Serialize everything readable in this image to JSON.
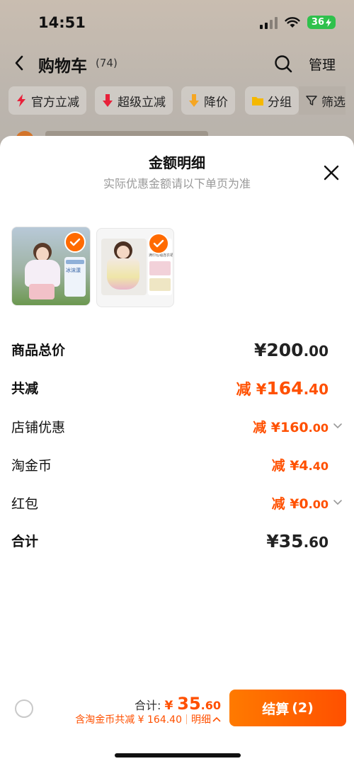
{
  "status_bar": {
    "time": "14:51",
    "battery": "36"
  },
  "nav": {
    "title": "购物车",
    "count": "(74)",
    "manage_label": "管理"
  },
  "filters": [
    {
      "label": "官方立减",
      "icon": "lightning-icon",
      "color": "#e8213a"
    },
    {
      "label": "超级立减",
      "icon": "down-arrow-icon",
      "color": "#e8213a"
    },
    {
      "label": "降价",
      "icon": "price-drop-icon",
      "color": "#f5a623"
    },
    {
      "label": "分组",
      "icon": "folder-icon",
      "color": "#f5b800"
    }
  ],
  "filter_button_label": "筛选",
  "sheet": {
    "title": "金额明细",
    "subtitle": "实际优惠金额请以下单页为准",
    "products": [
      {
        "name": "girl-outfit-thumbnail",
        "selected": true,
        "label": "冰沫漾"
      },
      {
        "name": "girl-dress-thumbnail",
        "selected": true,
        "label": "满印短袖连衣裙"
      }
    ],
    "rows": {
      "goods_total": {
        "label": "商品总价",
        "symbol": "¥",
        "integer": "200",
        "decimal": ".00"
      },
      "total_reduce": {
        "label": "共减",
        "prefix": "减 ",
        "symbol": "¥",
        "integer": "164",
        "decimal": ".40"
      },
      "store_discount": {
        "label": "店铺优惠",
        "prefix": "减 ",
        "symbol": "¥",
        "integer": "160",
        "decimal": ".00"
      },
      "taojinbi": {
        "label": "淘金币",
        "prefix": "减 ",
        "symbol": "¥",
        "integer": "4",
        "decimal": ".40"
      },
      "red_packet": {
        "label": "红包",
        "prefix": "减 ",
        "symbol": "¥",
        "integer": "0",
        "decimal": ".00"
      },
      "grand_total": {
        "label": "合计",
        "symbol": "¥",
        "integer": "35",
        "decimal": ".60"
      }
    }
  },
  "bottom_bar": {
    "total_label": "合计: ",
    "total_symbol": "¥ ",
    "total_integer": "35",
    "total_decimal": ".60",
    "saved_text": "含淘金币共减 ¥ 164.40",
    "detail_label": "明细",
    "checkout_label": "结算",
    "checkout_count": "(2)"
  },
  "colors": {
    "accent": "#ff5000",
    "checkout_start": "#ff7a00"
  }
}
